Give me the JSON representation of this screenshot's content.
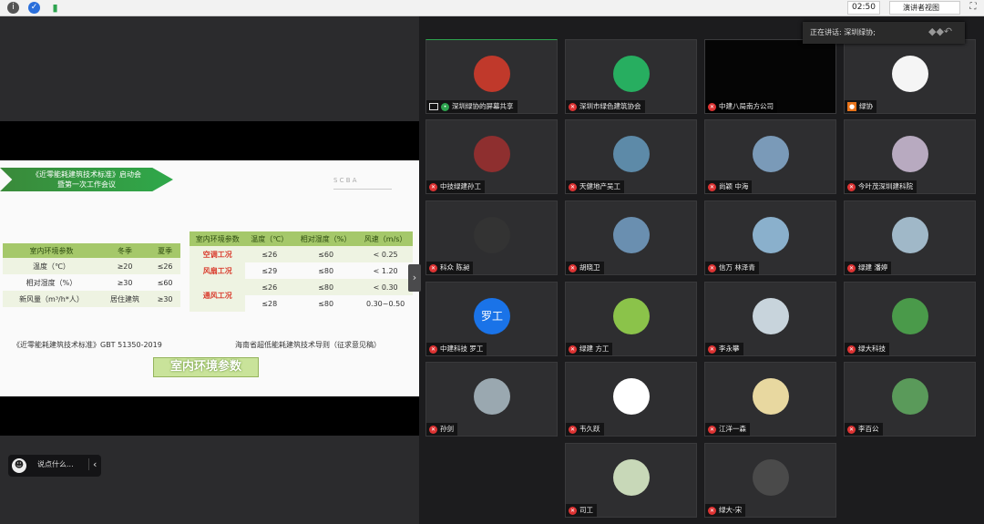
{
  "topbar": {
    "time": "02:50",
    "view_label": "演讲者视图",
    "fullscreen_icon": "expand-icon"
  },
  "speaker": {
    "text": "正在讲话: 深圳绿协;"
  },
  "slide": {
    "banner_line1": "《近零能耗建筑技术标准》启动会",
    "banner_line2": "暨第一次工作会议",
    "logo_text": "S C B A",
    "left_table": {
      "headers": [
        "室内环境参数",
        "冬季",
        "夏季"
      ],
      "rows": [
        [
          "温度（℃）",
          "≥20",
          "≤26"
        ],
        [
          "相对湿度（%）",
          "≥30",
          "≤60"
        ]
      ],
      "last_row_label": "新风量（m³/h*人）",
      "last_row_col2": "居住建筑",
      "last_row_col3": "≥30"
    },
    "right_table": {
      "headers": [
        "室内环境参数",
        "温度（℃）",
        "相对湿度（%）",
        "风速（m/s）"
      ],
      "row1": [
        "空调工况",
        "≤26",
        "≤60",
        "< 0.25"
      ],
      "row2": [
        "风扇工况",
        "≤29",
        "≤80",
        "< 1.20"
      ],
      "row3_label": "通风工况",
      "row3a": [
        "≤26",
        "≤80",
        "< 0.30"
      ],
      "row3b": [
        "≤28",
        "≤80",
        "0.30~0.50"
      ]
    },
    "cite_left": "《近零能耗建筑技术标准》GBT 51350-2019",
    "cite_right": "海南省超低能耗建筑技术导则（征求意见稿）",
    "subtitle": "室内环境参数"
  },
  "chat": {
    "placeholder": "说点什么..."
  },
  "participants": [
    {
      "name": "深圳绿协的屏幕共享",
      "color": "#c0392b"
    },
    {
      "name": "深圳市绿色建筑协会",
      "color": "#27ae60"
    },
    {
      "name": "中建八局南方公司",
      "color": "#000000"
    },
    {
      "name": "绿协",
      "color": "#f5f5f5"
    },
    {
      "name": "中技绿建孙工",
      "color": "#8e2f2f"
    },
    {
      "name": "天健地产吴工",
      "color": "#5d8aa8"
    },
    {
      "name": "尚颖 中海",
      "color": "#7a9ab8"
    },
    {
      "name": "今叶茂深圳建科院",
      "color": "#b8aac0"
    },
    {
      "name": "科众 陈昶",
      "color": "#333333"
    },
    {
      "name": "胡晓卫",
      "color": "#6a8fb0"
    },
    {
      "name": "信万 林泽青",
      "color": "#8ab0cc"
    },
    {
      "name": "绿建 潘婷",
      "color": "#a0b8c8"
    },
    {
      "name": "中建科技 罗工",
      "avatar_text": "罗工",
      "color": "#1a73e8"
    },
    {
      "name": "绿建 方工",
      "color": "#8bc34a"
    },
    {
      "name": "李永攀",
      "color": "#c8d4dc"
    },
    {
      "name": "绿大科技",
      "color": "#4a9a4a"
    },
    {
      "name": "孙剑",
      "color": "#9aa8b0"
    },
    {
      "name": "韦久跃",
      "color": "#ffffff"
    },
    {
      "name": "江洋一森",
      "color": "#e8d8a0"
    },
    {
      "name": "李百公",
      "color": "#5a9a5a"
    },
    {
      "name": "司工",
      "color": "#c8d8b8"
    },
    {
      "name": "绿大-宋",
      "color": "#4a4a4a"
    }
  ]
}
